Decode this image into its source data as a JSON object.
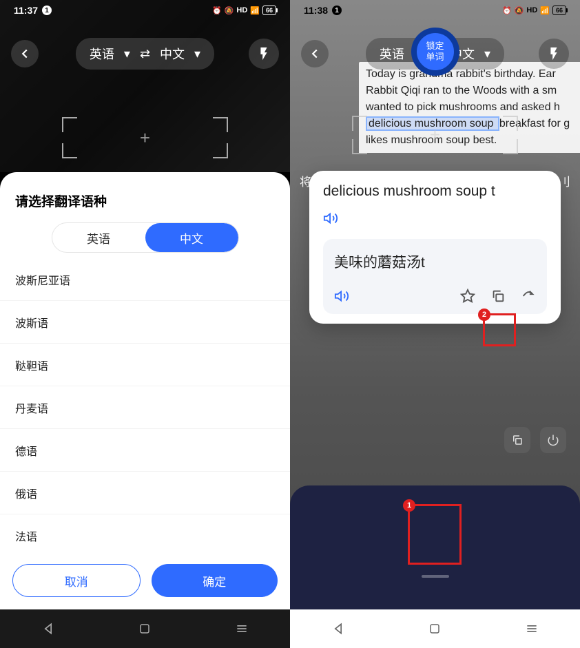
{
  "left": {
    "status": {
      "time": "11:37",
      "badge": "1",
      "battery": "66"
    },
    "lang_bar": {
      "source": "英语",
      "target": "中文"
    },
    "sheet": {
      "title": "请选择翻译语种",
      "segments": {
        "english": "英语",
        "chinese": "中文"
      },
      "languages": [
        "波斯尼亚语",
        "波斯语",
        "鞑靼语",
        "丹麦语",
        "德语",
        "俄语",
        "法语"
      ],
      "cancel": "取消",
      "confirm": "确定"
    }
  },
  "right": {
    "status": {
      "time": "11:38",
      "badge": "1",
      "battery": "66"
    },
    "lang_bar": {
      "source": "英语",
      "target": "中文"
    },
    "page_text": {
      "line1": "Today is grandma rabbit's birthday. Ear",
      "line2": "Rabbit Qiqi ran to the Woods with a sm",
      "line3": "wanted to pick mushrooms and asked h",
      "line4a": "delicious mushroom soup ",
      "line4b": "breakfast for g",
      "line5": "likes mushroom soup best."
    },
    "peek": {
      "left": "将",
      "right": "刂"
    },
    "card": {
      "source": "delicious mushroom soup t",
      "result": "美味的蘑菇汤t"
    },
    "capture": {
      "line1": "锁定",
      "line2": "单词"
    },
    "callouts": {
      "one": "1",
      "two": "2"
    }
  }
}
